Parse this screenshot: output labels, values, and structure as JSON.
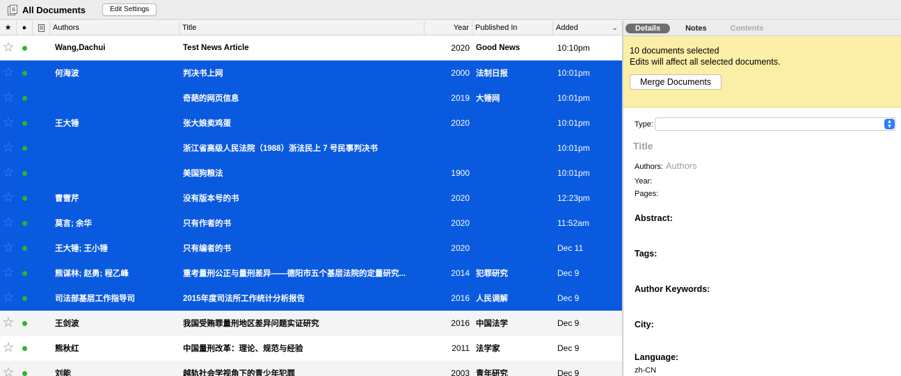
{
  "toolbar": {
    "title": "All Documents",
    "edit_settings_label": "Edit Settings"
  },
  "columns": {
    "star": "★",
    "dot": "●",
    "authors": "Authors",
    "title": "Title",
    "year": "Year",
    "published_in": "Published In",
    "added": "Added"
  },
  "rows": [
    {
      "authors": "Wang,Dachui",
      "title": "Test News Article",
      "year": "2020",
      "published_in": "Good News",
      "added": "10:10pm",
      "state": "white"
    },
    {
      "authors": "何海波",
      "title": "判决书上网",
      "year": "2000",
      "published_in": "法制日报",
      "added": "10:01pm",
      "state": "sel"
    },
    {
      "authors": "",
      "title": "奇葩的网页信息",
      "year": "2019",
      "published_in": "大锤网",
      "added": "10:01pm",
      "state": "sel"
    },
    {
      "authors": "王大锤",
      "title": "张大娘卖鸡蛋",
      "year": "2020",
      "published_in": "",
      "added": "10:01pm",
      "state": "sel"
    },
    {
      "authors": "",
      "title": "浙江省高级人民法院（1988）浙法民上 7 号民事判决书",
      "year": "",
      "published_in": "",
      "added": "10:01pm",
      "state": "sel"
    },
    {
      "authors": "",
      "title": "美国狗粮法",
      "year": "1900",
      "published_in": "",
      "added": "10:01pm",
      "state": "sel"
    },
    {
      "authors": "曹雪芹",
      "title": "没有版本号的书",
      "year": "2020",
      "published_in": "",
      "added": "12:23pm",
      "state": "sel"
    },
    {
      "authors": "莫言; 余华",
      "title": "只有作者的书",
      "year": "2020",
      "published_in": "",
      "added": "11:52am",
      "state": "sel"
    },
    {
      "authors": "王大锤; 王小锤",
      "title": "只有编者的书",
      "year": "2020",
      "published_in": "",
      "added": "Dec 11",
      "state": "sel"
    },
    {
      "authors": "熊谋林; 赵勇; 程乙峰",
      "title": "重考量刑公正与量刑差异——德阳市五个基层法院的定量研究...",
      "year": "2014",
      "published_in": "犯罪研究",
      "added": "Dec 9",
      "state": "sel"
    },
    {
      "authors": "司法部基层工作指导司",
      "title": "2015年度司法所工作统计分析报告",
      "year": "2016",
      "published_in": "人民调解",
      "added": "Dec 9",
      "state": "sel"
    },
    {
      "authors": "王剑波",
      "title": "我国受贿罪量刑地区差异问题实证研究",
      "year": "2016",
      "published_in": "中国法学",
      "added": "Dec 9",
      "state": "alt"
    },
    {
      "authors": "熊秋红",
      "title": "中国量刑改革：理论、规范与经验",
      "year": "2011",
      "published_in": "法学家",
      "added": "Dec 9",
      "state": "white"
    },
    {
      "authors": "刘能",
      "title": "越轨社会学视角下的青少年犯罪",
      "year": "2003",
      "published_in": "青年研究",
      "added": "Dec 9",
      "state": "alt"
    }
  ],
  "panel": {
    "tabs": {
      "details": "Details",
      "notes": "Notes",
      "contents": "Contents"
    },
    "banner_line1": "10 documents selected",
    "banner_line2": "Edits will affect all selected documents.",
    "merge_label": "Merge Documents",
    "type_label": "Type:",
    "title_placeholder": "Title",
    "authors_label": "Authors:",
    "authors_placeholder": "Authors",
    "year_label": "Year:",
    "pages_label": "Pages:",
    "abstract_label": "Abstract:",
    "tags_label": "Tags:",
    "keywords_label": "Author Keywords:",
    "city_label": "City:",
    "language_label": "Language:",
    "language_value": "zh-CN"
  },
  "colors": {
    "selection": "#0a5ae0",
    "banner": "#fbeea6",
    "unread_dot": "#2bb52b"
  },
  "icons": {
    "star": "star-icon",
    "read_status": "unread-dot-icon",
    "attachment": "attachment-icon",
    "sort": "chevron-down-icon",
    "type_select": "up-down-arrows-icon"
  }
}
